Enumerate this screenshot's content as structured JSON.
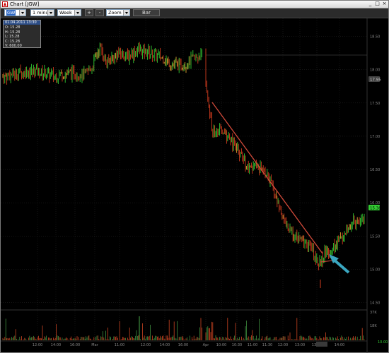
{
  "window": {
    "title": "Chart [JGW]",
    "buttons": {
      "minimize": "_",
      "maximize": "□",
      "close": "×"
    }
  },
  "toolbar": {
    "symbol": "GW",
    "interval": "1 minute",
    "range": "Week",
    "zoom_in": "+",
    "zoom_out": "-",
    "zoom": "Zoom",
    "chart_type": "Bar"
  },
  "data_box": {
    "date": "01.04.2011 13:30",
    "open": "O: 15.28",
    "high": "H: 15.28",
    "low": "L: 15.28",
    "close": "C: 15.28",
    "volume": "V: 600.00"
  },
  "colors": {
    "up": "#33cc33",
    "down": "#d23c1e",
    "neutral": "#e0a030",
    "trendline": "#d14a3a",
    "arrow": "#3aa6c0",
    "volume": "#cc4422",
    "price_badge": "#33cc33",
    "grid": "#2a2a2a"
  },
  "chart_data": {
    "type": "bar",
    "y_ticks": [
      "18.50",
      "18.00",
      "17.50",
      "17.00",
      "16.50",
      "16.00",
      "15.50",
      "15.00",
      "14.50"
    ],
    "ylim": [
      14.4,
      18.75
    ],
    "x_ticks": [
      "12:00",
      "14:00",
      "16:00",
      "Mar",
      "11:00",
      "12:00",
      "14:00",
      "16:00",
      "Apr",
      "10:00",
      "10:30",
      "11:00",
      "11:30",
      "12:00",
      "13:00",
      "13:30",
      "14:00"
    ],
    "current_price_label": "15.38",
    "secondary_price_label": "17.95",
    "volume_ticks": [
      "37K",
      "18K"
    ],
    "volume_bottom_label": "10.00",
    "highlighted_time": "13:30",
    "price_path": [
      [
        0,
        17.88
      ],
      [
        25,
        17.95
      ],
      [
        50,
        17.98
      ],
      [
        75,
        17.9
      ],
      [
        100,
        17.95
      ],
      [
        118,
        17.92
      ],
      [
        130,
        18.05
      ],
      [
        140,
        18.35
      ],
      [
        150,
        18.1
      ],
      [
        165,
        18.25
      ],
      [
        180,
        18.2
      ],
      [
        195,
        18.3
      ],
      [
        210,
        18.25
      ],
      [
        225,
        18.2
      ],
      [
        240,
        18.1
      ],
      [
        255,
        18.05
      ],
      [
        270,
        18.15
      ],
      [
        285,
        18.22
      ],
      [
        292,
        17.62
      ],
      [
        296,
        17.3
      ],
      [
        300,
        17.05
      ],
      [
        310,
        17.1
      ],
      [
        325,
        16.95
      ],
      [
        340,
        16.7
      ],
      [
        350,
        16.5
      ],
      [
        365,
        16.55
      ],
      [
        380,
        16.35
      ],
      [
        393,
        15.95
      ],
      [
        405,
        15.62
      ],
      [
        420,
        15.45
      ],
      [
        435,
        15.38
      ],
      [
        452,
        15.08
      ],
      [
        458,
        15.25
      ],
      [
        466,
        15.28
      ],
      [
        480,
        15.45
      ],
      [
        500,
        15.72
      ],
      [
        515,
        15.78
      ]
    ]
  }
}
